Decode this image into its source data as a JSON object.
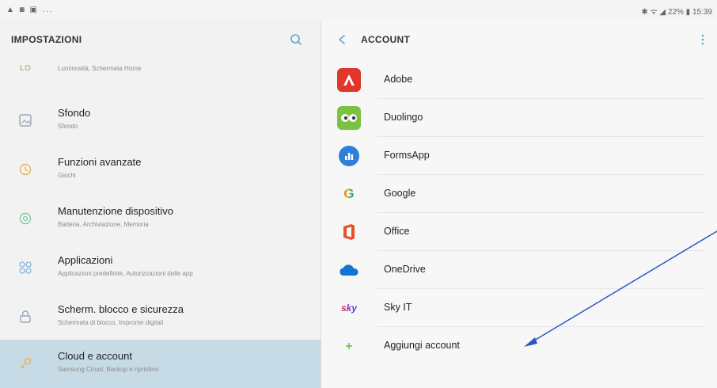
{
  "status_bar": {
    "left_icons": "▲ ◙ ▣ ...",
    "right_text": "✱ ᯤ ◢ 22% ▮ 15:39"
  },
  "left_pane": {
    "title": "IMPOSTAZIONI",
    "partial_item": {
      "subtitle": "Luminosità, Schermata Home"
    },
    "items": [
      {
        "title": "Sfondo",
        "subtitle": "Sfondo",
        "icon": "wallpaper-icon",
        "color": "#9aa8b8"
      },
      {
        "title": "Funzioni avanzate",
        "subtitle": "Giochi",
        "icon": "advanced-features-icon",
        "color": "#e8b25a"
      },
      {
        "title": "Manutenzione dispositivo",
        "subtitle": "Batteria, Archiviazione, Memoria",
        "icon": "device-maintenance-icon",
        "color": "#7fc7a0"
      },
      {
        "title": "Applicazioni",
        "subtitle": "Applicazioni predefinite, Autorizzazioni delle app",
        "icon": "apps-icon",
        "color": "#8ab4e0"
      },
      {
        "title": "Scherm. blocco e sicurezza",
        "subtitle": "Schermata di blocco, Impronte digitali",
        "icon": "lock-icon",
        "color": "#9aa8b8"
      },
      {
        "title": "Cloud e account",
        "subtitle": "Samsung Cloud, Backup e ripristino",
        "icon": "key-icon",
        "color": "#e8b25a"
      }
    ]
  },
  "right_pane": {
    "title": "ACCOUNT",
    "accounts": [
      {
        "name": "Adobe",
        "icon": "adobe-icon",
        "color": "#e0362b",
        "glyph": "A"
      },
      {
        "name": "Duolingo",
        "icon": "duolingo-icon",
        "color": "#7cc242",
        "glyph": "••"
      },
      {
        "name": "FormsApp",
        "icon": "formsapp-icon",
        "color": "#2f7fd8",
        "glyph": "▮"
      },
      {
        "name": "Google",
        "icon": "google-icon",
        "color": "#ffffff",
        "glyph": "G"
      },
      {
        "name": "Office",
        "icon": "office-icon",
        "color": "#e6522c",
        "glyph": "O"
      },
      {
        "name": "OneDrive",
        "icon": "onedrive-icon",
        "color": "#1475d1",
        "glyph": "☁"
      },
      {
        "name": "Sky IT",
        "icon": "sky-icon",
        "color": "#ffffff",
        "glyph": "sky"
      },
      {
        "name": "Aggiungi account",
        "icon": "add-icon",
        "color": "#ffffff",
        "glyph": "+"
      }
    ]
  },
  "colors": {
    "selected_bg": "#c7dbe7",
    "accent": "#5fa8c8",
    "arrow": "#2b59c3"
  }
}
